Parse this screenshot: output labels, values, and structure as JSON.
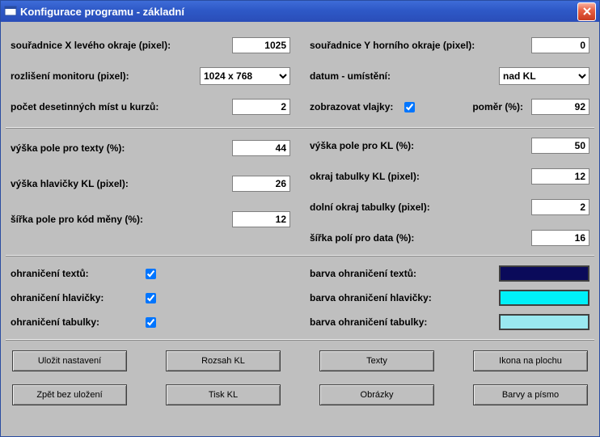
{
  "window": {
    "title": "Konfigurace programu - základní"
  },
  "sec1": {
    "left": {
      "coord_x_label": "souřadnice X  levého okraje (pixel):",
      "coord_x_value": "1025",
      "resolution_label": "rozlišení monitoru (pixel):",
      "resolution_value": "1024 x 768",
      "decimals_label": "počet desetinných míst u kurzů:",
      "decimals_value": "2"
    },
    "right": {
      "coord_y_label": "souřadnice Y horního okraje (pixel):",
      "coord_y_value": "0",
      "date_pos_label": "datum - umístění:",
      "date_pos_value": "nad KL",
      "flags_label": "zobrazovat vlajky:",
      "flags_checked": true,
      "ratio_label": "poměr (%):",
      "ratio_value": "92"
    }
  },
  "sec2": {
    "left": {
      "text_height_label": "výška pole pro texty (%):",
      "text_height_value": "44",
      "kl_header_label": "výška hlavičky KL (pixel):",
      "kl_header_value": "26",
      "code_width_label": "šířka pole pro kód měny (%):",
      "code_width_value": "12"
    },
    "right": {
      "kl_height_label": "výška pole pro KL (%):",
      "kl_height_value": "50",
      "kl_margin_label": "okraj tabulky KL (pixel):",
      "kl_margin_value": "12",
      "bot_margin_label": "dolní okraj tabulky (pixel):",
      "bot_margin_value": "2",
      "data_width_label": "šířka polí pro data (%):",
      "data_width_value": "16"
    }
  },
  "sec3": {
    "left": {
      "border_text_label": "ohraničení textů:",
      "border_text_checked": true,
      "border_header_label": "ohraničení hlavičky:",
      "border_header_checked": true,
      "border_table_label": "ohraničení tabulky:",
      "border_table_checked": true
    },
    "right": {
      "color_text_label": "barva ohraničení textů:",
      "color_text": "#0A0A5A",
      "color_header_label": "barva ohraničení hlavičky:",
      "color_header": "#00F0F8",
      "color_table_label": "barva ohraničení tabulky:",
      "color_table": "#9AE8F0"
    }
  },
  "buttons": {
    "save": "Uložit nastavení",
    "scope": "Rozsah KL",
    "texts": "Texty",
    "icon": "Ikona na plochu",
    "cancel": "Zpět bez uložení",
    "print": "Tisk KL",
    "images": "Obrázky",
    "colors": "Barvy a písmo"
  }
}
